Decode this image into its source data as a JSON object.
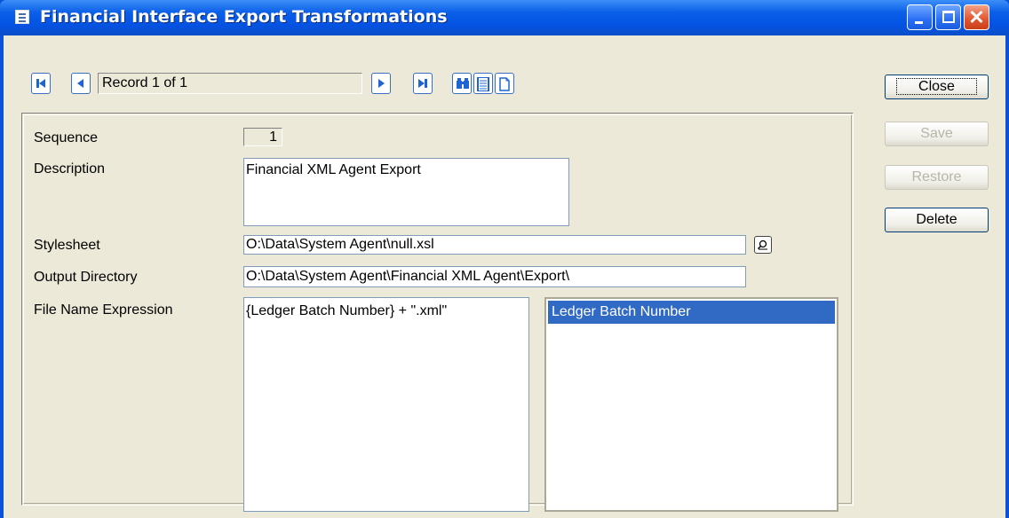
{
  "window": {
    "title": "Financial Interface Export Transformations"
  },
  "navigation": {
    "record_text": "Record 1 of 1"
  },
  "buttons": {
    "close": "Close",
    "save": "Save",
    "restore": "Restore",
    "delete": "Delete"
  },
  "form": {
    "sequence_label": "Sequence",
    "sequence_value": "1",
    "description_label": "Description",
    "description_value": "Financial XML Agent Export",
    "stylesheet_label": "Stylesheet",
    "stylesheet_value": "O:\\Data\\System Agent\\null.xsl",
    "output_directory_label": "Output Directory",
    "output_directory_value": "O:\\Data\\System Agent\\Financial XML Agent\\Export\\",
    "file_name_expression_label": "File Name Expression",
    "file_name_expression_value": "{Ledger Batch Number} + \".xml\""
  },
  "field_list": {
    "items": [
      "Ledger Batch Number"
    ]
  },
  "icons": {
    "title": "form-icon",
    "first": "first-record-icon",
    "prev": "previous-record-icon",
    "next": "next-record-icon",
    "last": "last-record-icon",
    "find": "binoculars-icon",
    "list": "list-view-icon",
    "new": "new-document-icon",
    "browse": "browse-file-icon"
  },
  "colors": {
    "title_bar": "#0553e3",
    "selection": "#316ac5",
    "nav_arrow": "#1e64d4",
    "window_bg": "#ece9d8"
  }
}
